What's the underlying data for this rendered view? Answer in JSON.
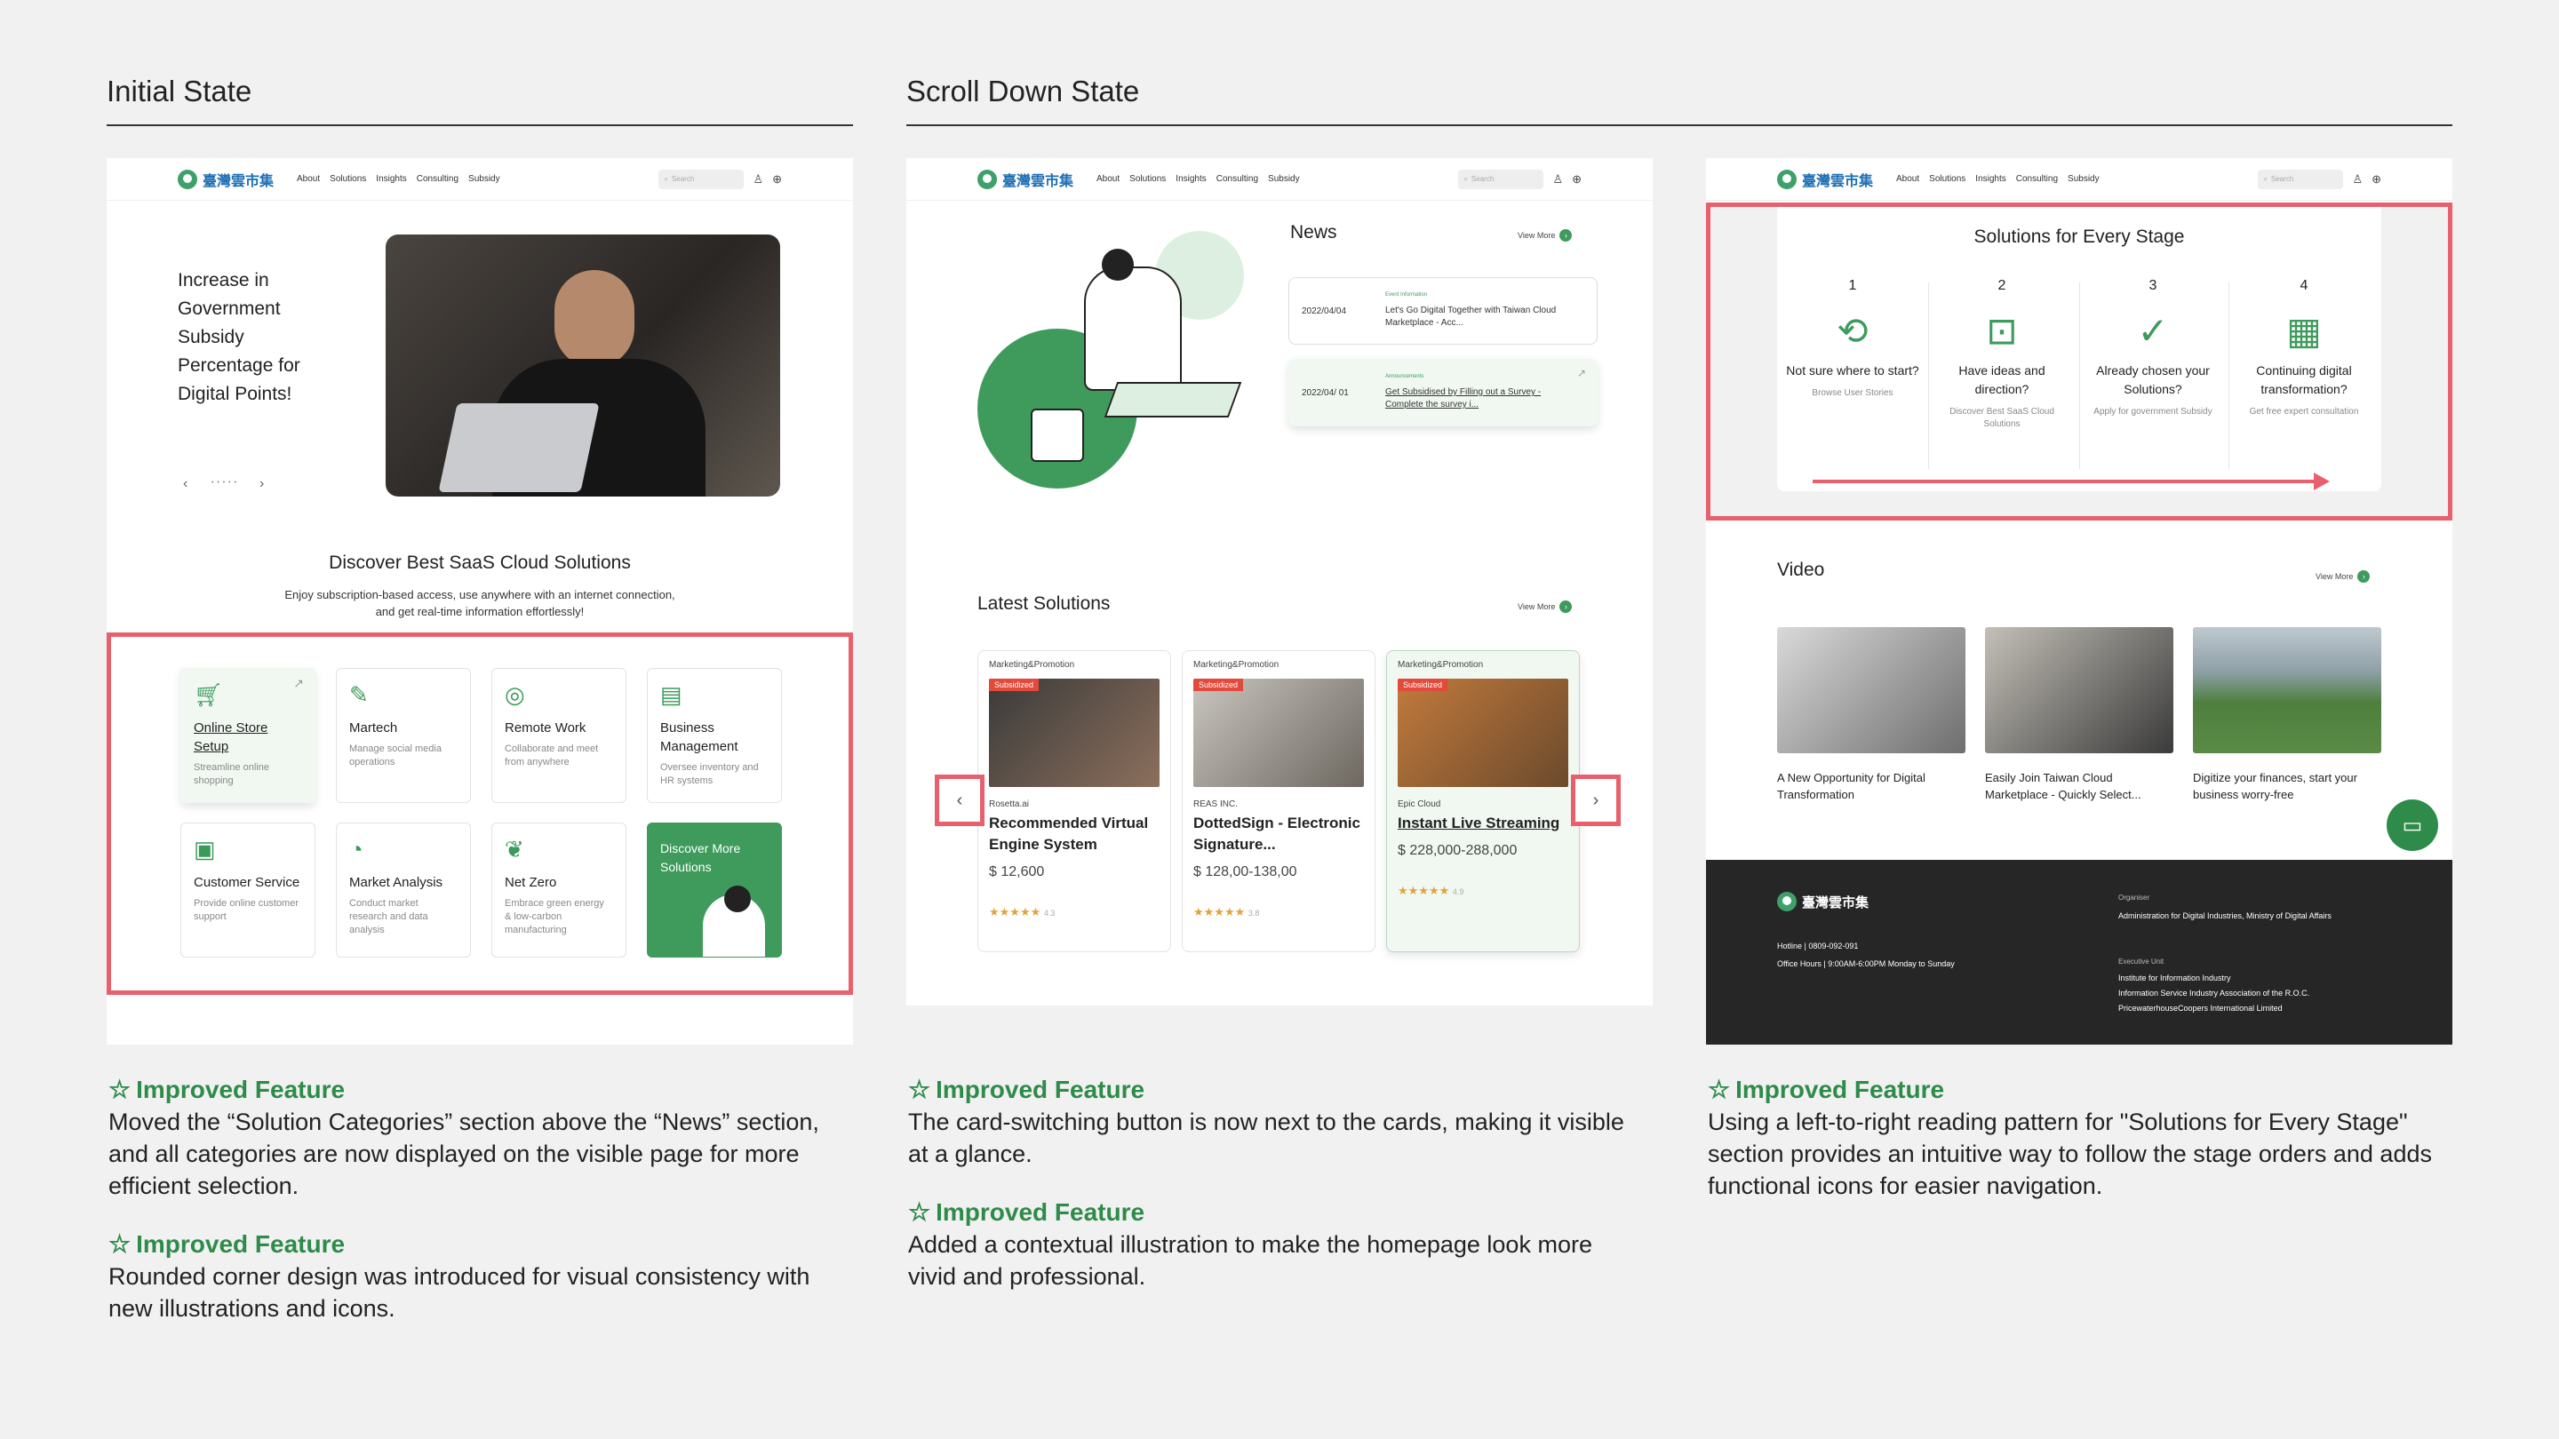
{
  "columns": {
    "initial_title": "Initial State",
    "scroll_title": "Scroll Down State"
  },
  "nav": {
    "logo_text": "臺灣雲市集",
    "links": [
      "About",
      "Solutions",
      "Insights",
      "Consulting",
      "Subsidy"
    ],
    "search_placeholder": "Search"
  },
  "hero": {
    "text": "Increase in Government Subsidy Percentage for Digital Points!",
    "prev": "‹",
    "next": "›",
    "dots": "• • • • •"
  },
  "discover": {
    "title": "Discover Best SaaS Cloud Solutions",
    "subtitle_1": "Enjoy subscription-based access, use anywhere with an internet connection,",
    "subtitle_2": "and get real-time information effortlessly!"
  },
  "categories": [
    {
      "title": "Online Store Setup",
      "desc": "Streamline online shopping",
      "icon": "cart-icon"
    },
    {
      "title": "Martech",
      "desc": "Manage social media operations",
      "icon": "pen-tool-icon"
    },
    {
      "title": "Remote Work",
      "desc": "Collaborate and meet from anywhere",
      "icon": "globe-icon"
    },
    {
      "title": "Business Management",
      "desc": "Oversee inventory and HR systems",
      "icon": "chart-board-icon"
    },
    {
      "title": "Customer Service",
      "desc": "Provide online customer support",
      "icon": "contact-card-icon"
    },
    {
      "title": "Market Analysis",
      "desc": "Conduct market research and data analysis",
      "icon": "pie-chart-icon"
    },
    {
      "title": "Net Zero",
      "desc": "Embrace green energy & low-carbon manufacturing",
      "icon": "leaf-globe-icon"
    },
    {
      "title": "Discover More Solutions",
      "desc": "",
      "icon": "illustration"
    }
  ],
  "news": {
    "title": "News",
    "view_more": "View More",
    "items": [
      {
        "date": "2022/04/04",
        "tag": "Event Information",
        "text": "Let's Go Digital Together with Taiwan Cloud Marketplace  - Acc..."
      },
      {
        "date": "2022/04/ 01",
        "tag": "Announcements",
        "text": "Get Subsidised by Filling out a Survey - Complete the survey i..."
      }
    ]
  },
  "latest": {
    "title": "Latest Solutions",
    "view_more": "View More",
    "prev": "‹",
    "next": "›",
    "cards": [
      {
        "category": "Marketing&Promotion",
        "subsidized": "Subsidized",
        "company": "Rosetta.ai",
        "name": "Recommended Virtual Engine System",
        "price": "$ 12,600",
        "stars": "★★★★★",
        "rating": "4.3"
      },
      {
        "category": "Marketing&Promotion",
        "subsidized": "Subsidized",
        "company": "REAS INC.",
        "name": "DottedSign - Electronic Signature...",
        "price": "$ 128,00-138,00",
        "stars": "★★★★★",
        "rating": "3.8"
      },
      {
        "category": "Marketing&Promotion",
        "subsidized": "Subsidized",
        "company": "Epic Cloud",
        "name": "Instant Live Streaming",
        "price": "$ 228,000-288,000",
        "stars": "★★★★★",
        "rating": "4.9"
      }
    ]
  },
  "stages": {
    "title": "Solutions for Every Stage",
    "items": [
      {
        "num": "1",
        "question": "Not sure where to start?",
        "desc": "Browse User Stories",
        "icon": "refresh-icon"
      },
      {
        "num": "2",
        "question": "Have ideas and direction?",
        "desc": "Discover Best SaaS Cloud Solutions",
        "icon": "monitor-chart-icon"
      },
      {
        "num": "3",
        "question": "Already chosen your Solutions?",
        "desc": "Apply for government Subsidy",
        "icon": "check-plus-icon"
      },
      {
        "num": "4",
        "question": "Continuing digital transformation?",
        "desc": "Get free expert consultation",
        "icon": "document-person-icon"
      }
    ]
  },
  "video": {
    "title": "Video",
    "view_more": "View More",
    "items": [
      {
        "caption": "A New Opportunity for Digital Transformation"
      },
      {
        "caption": "Easily Join Taiwan Cloud Marketplace - Quickly Select..."
      },
      {
        "caption": "Digitize your finances, start your business worry-free"
      }
    ]
  },
  "footer": {
    "logo_text": "臺灣雲市集",
    "hotline": "Hotline  |  0809-092-091",
    "office_hours": "Office Hours  |  9:00AM-6:00PM Monday to Sunday",
    "organiser_label": "Organiser",
    "organiser": "Administration for Digital Industries, Ministry of Digital Affairs",
    "exec_label": "Executive Unit",
    "exec_1": "Institute for Information Industry",
    "exec_2": "Information Service Industry Association of the R.O.C.",
    "exec_3": "PricewaterhouseCoopers International Limited"
  },
  "features": {
    "col1": [
      {
        "heading": "Improved Feature",
        "body": "Moved the “Solution Categories” section above the “News” section, and all categories are now displayed on the visible page for more efficient selection."
      },
      {
        "heading": "Improved Feature",
        "body": "Rounded corner design was introduced  for visual consistency with new illustrations and icons."
      }
    ],
    "col2": [
      {
        "heading": "Improved Feature",
        "body": "The card-switching button is now next to the cards, making it visible at a glance."
      },
      {
        "heading": "Improved Feature",
        "body": "Added a contextual illustration to make the homepage look more vivid and  professional."
      }
    ],
    "col3": [
      {
        "heading": "Improved Feature",
        "body": "Using a left-to-right reading pattern for \"Solutions for Every Stage\" section provides an intuitive way to follow the stage orders and adds functional icons for easier navigation."
      }
    ]
  },
  "colors": {
    "accent": "#3e9b5c",
    "highlight": "#e8606c",
    "feature_green": "#2e8b49"
  }
}
